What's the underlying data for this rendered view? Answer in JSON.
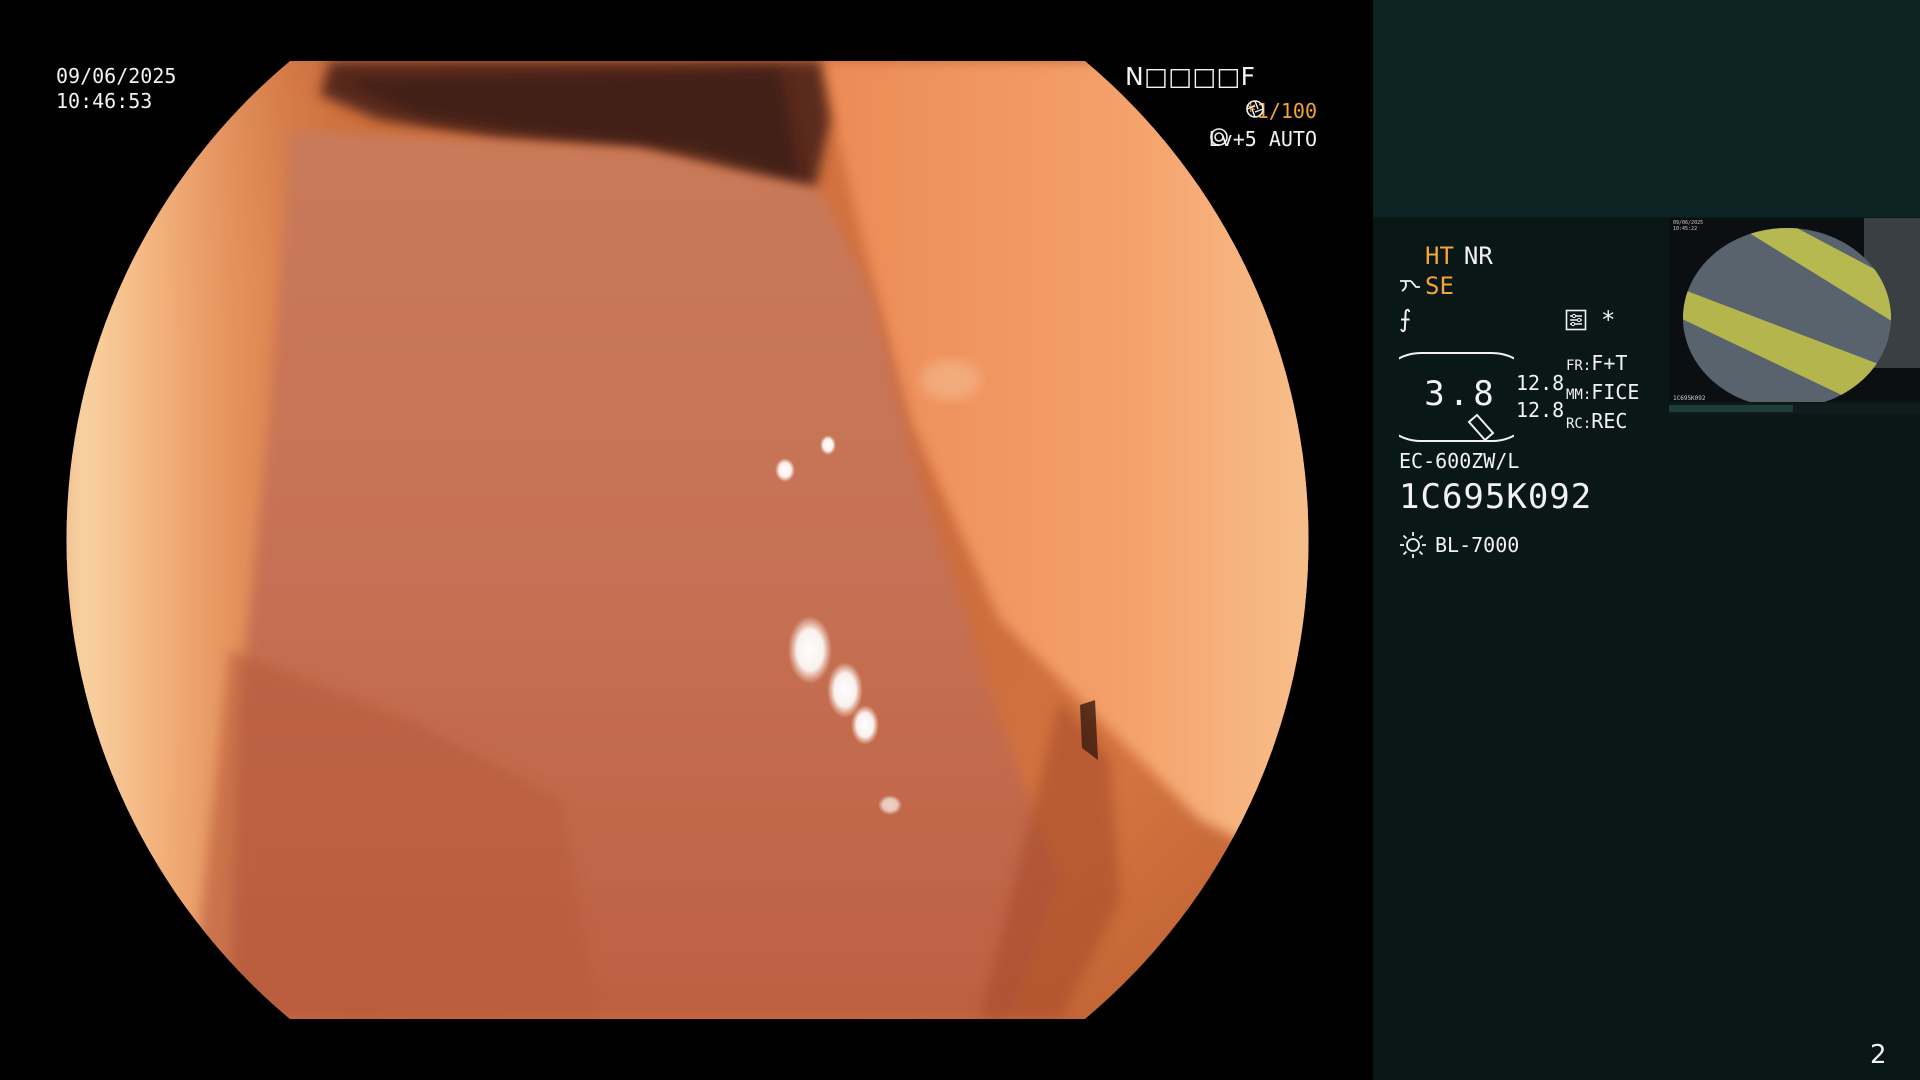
{
  "overlay": {
    "date": "09/06/2025",
    "time": "10:46:53",
    "patient_id": "N□□□□F",
    "shutter": "*1/100",
    "iris": "Lv+5 AUTO",
    "shutter_icon": "aperture-icon",
    "iris_icon": "iris-icon"
  },
  "panel": {
    "ht": "HT",
    "nr": "NR",
    "se": "SE",
    "freeze_symbol": "⨍",
    "settings_star": "*",
    "zoom_value": "3.8",
    "magnification": [
      "12.8",
      "12.8"
    ],
    "modes": [
      {
        "key": "FR:",
        "value": "F+T"
      },
      {
        "key": "MM:",
        "value": "FICE"
      },
      {
        "key": "RC:",
        "value": "REC"
      }
    ],
    "scope_model": "EC-600ZW/L",
    "scope_serial": "1C695K092",
    "light_source": "BL-7000",
    "thumbnail_label": "1C695K092",
    "page_number": "2"
  },
  "colors": {
    "accent_orange": "#f2a43a",
    "panel_bg": "#0a1717",
    "panel_top_bg": "#0c2424",
    "text": "#f2f2f2"
  }
}
